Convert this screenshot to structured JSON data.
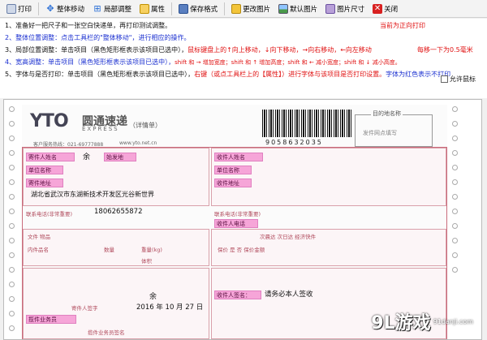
{
  "toolbar": {
    "buttons": [
      {
        "label": "打印",
        "color": "#2a6fd6"
      },
      {
        "label": "整体移动",
        "color": "#2a6fd6"
      },
      {
        "label": "局部调整",
        "color": "#2a6fd6"
      },
      {
        "label": "属性",
        "color": "#e8a100"
      },
      {
        "label": "保存格式",
        "color": "#3a6fb0"
      },
      {
        "label": "更改图片",
        "color": "#d8a400"
      },
      {
        "label": "默认图片",
        "color": "#3a8f3a"
      },
      {
        "label": "图片尺寸",
        "color": "#6a4fa0"
      },
      {
        "label": "关闭",
        "color": "#d82020"
      }
    ]
  },
  "instructions": {
    "line1": "1、准备好一把尺子和一张空白快递单，再打印测试调整。",
    "line1_status": "当前为正向打印",
    "line2_a": "2、整体位置调整：点击工具栏的",
    "line2_b": "\"整体移动\"",
    "line2_c": "，进行相应的操作。",
    "line3_a": "3、局部位置调整：单击项目（黑色矩形框表示该项目已选中），",
    "line3_b": "鼠标键盘上的↑向上移动，↓向下移动，→向右移动，←向左移动",
    "line3_c": "每移一下为0.5毫米",
    "line4_a": "4、宽高调整：单击项目（黑色矩形框表示该项目已选中），",
    "line4_b": "shift 和 →  增加宽度；shift 和 ↑  增加高度；shift 和 ←  减小宽度；shift 和 ↓  减小高度。",
    "line5_a": "5、字体与是否打印：单击项目（黑色矩形框表示该项目已选中），",
    "line5_b": "右键（或点工具栏上的【属性】）进行字体与该项目是否打印设置。",
    "line5_c": "字体为红色表示不打印",
    "checkbox_label": "允许鼠标"
  },
  "waybill": {
    "logo": "YTO",
    "logo_cn": "圆通速递",
    "logo_en": "EXPRESS",
    "logo_sub": "（详情单）",
    "hotline": "客户服务热线：021-69777888",
    "url": "www.yto.net.cn",
    "barcode_number": "9058632035",
    "dest_label": "目的地名称",
    "dest_hint": "发件网点填写",
    "fields": {
      "sender_name_tag": "寄件人姓名",
      "sender_name_val": "余",
      "start_place_tag": "始发地",
      "unit_name_tag": "单位名称",
      "sender_addr_tag": "寄件地址",
      "sender_addr_val": "湖北省武汉市东湖新技术开发区光谷新世界",
      "phone_label": "联系电话(非常重要)",
      "phone_val": "18062655872",
      "recv_name_tag": "收件人姓名",
      "recv_unit_tag": "单位名称",
      "recv_addr_tag": "收件地址",
      "recv_phone_label": "联系电话(非常重要)",
      "recv_phone_tag": "收件人电话",
      "goods_type_label": "文件  物品",
      "content_label": "内件品名",
      "qty_label": "数量",
      "weight_label": "重量(kg)",
      "volume_label": "体积",
      "declare_label": "寄件人签字",
      "sign_val": "余",
      "date_val": "2016 年 10 月 27 日",
      "delivery_label": "次晨达  次日达  经济快件",
      "insure_label": "保价  是  否  保价金额",
      "recv_sign_label": "收件人签名：",
      "recv_sign_val": "请务必本人签收",
      "courier_label": "揽件业务员签名",
      "courier_tag": "揽件业务员"
    }
  },
  "watermark": {
    "logo": "9L游戏",
    "site": "91danji.com"
  }
}
